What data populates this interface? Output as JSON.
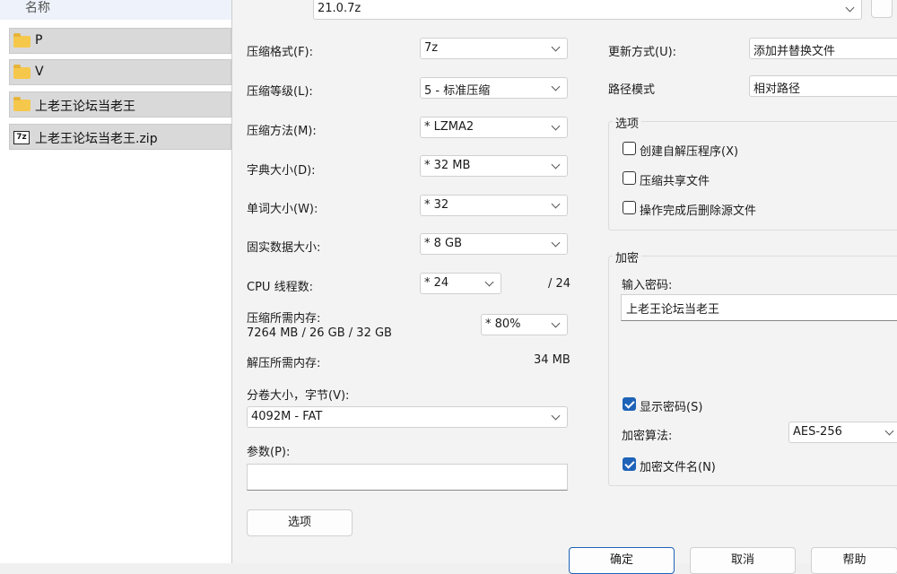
{
  "file_list": {
    "column_header": "名称",
    "items": [
      {
        "name": "P",
        "icon": "folder-icon"
      },
      {
        "name": "V",
        "icon": "folder-icon"
      },
      {
        "name": "上老王论坛当老王",
        "icon": "folder-icon"
      },
      {
        "name": "上老王论坛当老王.zip",
        "icon": "zip-icon",
        "icon_text": "7z"
      }
    ]
  },
  "dialog": {
    "archive_name": "21.0.7z",
    "left": {
      "format_label": "压缩格式(F):",
      "format_value": "7z",
      "level_label": "压缩等级(L):",
      "level_value": "5 - 标准压缩",
      "method_label": "压缩方法(M):",
      "method_value": "* LZMA2",
      "dict_label": "字典大小(D):",
      "dict_value": "* 32 MB",
      "word_label": "单词大小(W):",
      "word_value": "* 32",
      "solid_label": "固实数据大小:",
      "solid_value": "* 8 GB",
      "threads_label": "CPU 线程数:",
      "threads_value": "* 24",
      "threads_max": "/ 24",
      "mem_label": "压缩所需内存:",
      "mem_value": "7264 MB / 26 GB / 32 GB",
      "mem_percent": "* 80%",
      "decomp_label": "解压所需内存:",
      "decomp_value": "34 MB",
      "volume_label": "分卷大小，字节(V):",
      "volume_value": "4092M - FAT",
      "params_label": "参数(P):",
      "params_value": "",
      "options_button": "选项"
    },
    "right": {
      "update_label": "更新方式(U):",
      "update_value": "添加并替换文件",
      "path_label": "路径模式",
      "path_value": "相对路径",
      "options_group": "选项",
      "opt_sfx": "创建自解压程序(X)",
      "opt_shared": "压缩共享文件",
      "opt_delete": "操作完成后删除源文件",
      "encrypt_group": "加密",
      "password_label": "输入密码:",
      "password_value": "上老王论坛当老王",
      "show_password": "显示密码(S)",
      "show_password_checked": true,
      "algo_label": "加密算法:",
      "algo_value": "AES-256",
      "encrypt_names": "加密文件名(N)",
      "encrypt_names_checked": true
    },
    "buttons": {
      "ok": "确定",
      "cancel": "取消",
      "help": "帮助"
    }
  },
  "colors": {
    "accent": "#1e63b8",
    "folder": "#f5c84c",
    "row_selected": "#d9d9d9"
  }
}
